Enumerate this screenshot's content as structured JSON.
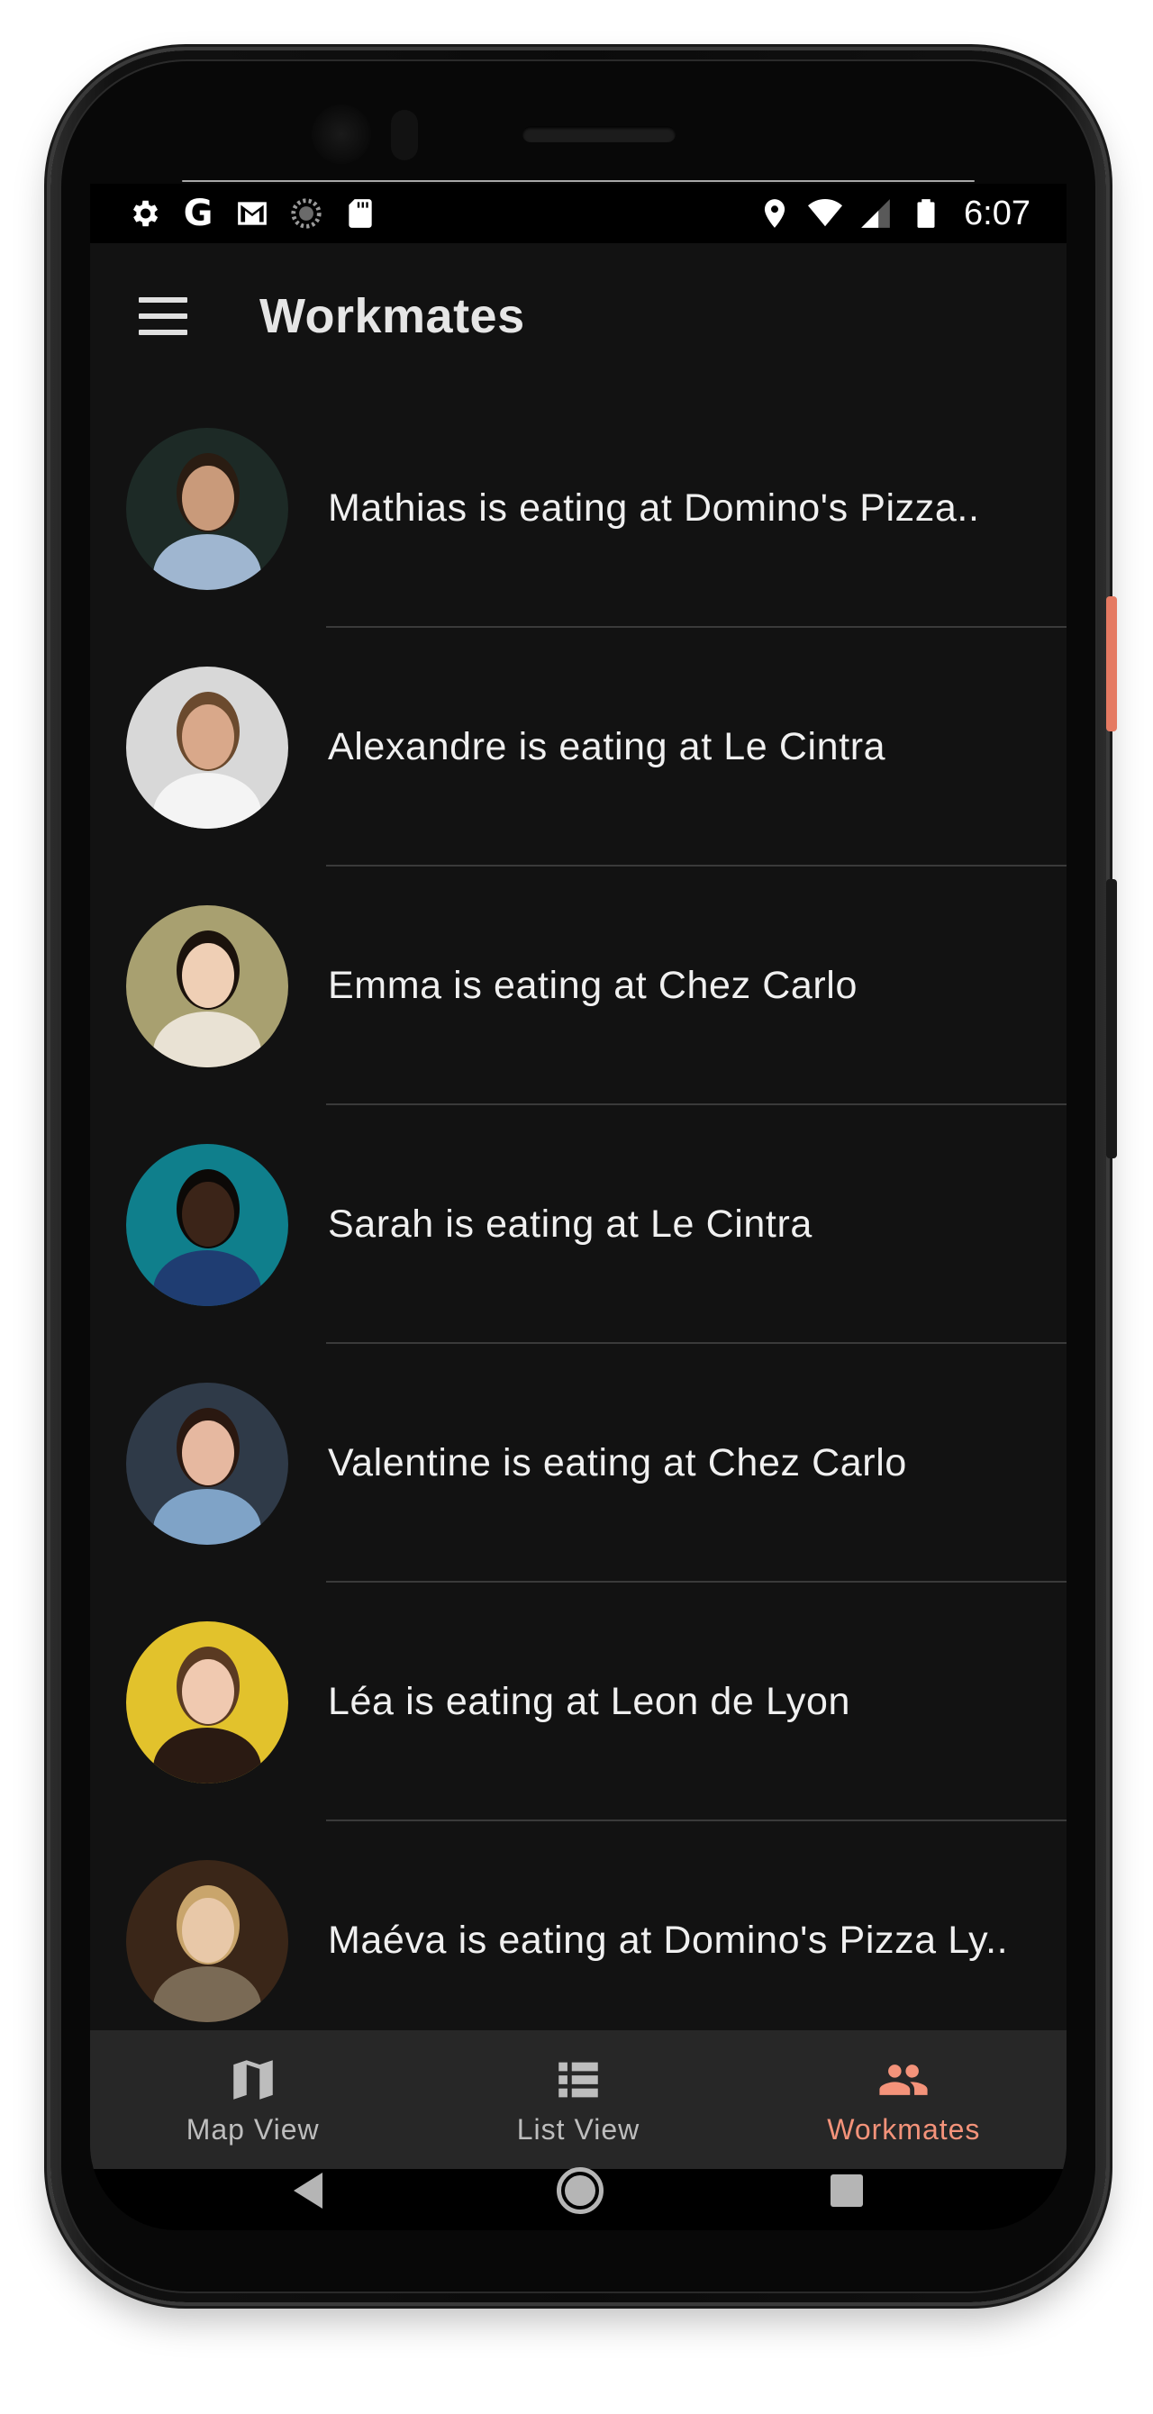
{
  "status_bar": {
    "time": "6:07",
    "left_icons": [
      "settings-icon",
      "google-icon",
      "gmail-icon",
      "loading-icon",
      "sd-card-icon"
    ],
    "right_icons": [
      "location-icon",
      "wifi-icon",
      "signal-icon",
      "battery-icon"
    ],
    "google_letter": "G"
  },
  "app_bar": {
    "title": "Workmates",
    "menu_icon": "menu-icon"
  },
  "workmates": [
    {
      "text": "Mathias is eating at Domino's Pizza..",
      "bg": "#1d2a26",
      "skin": "#c99a7a",
      "shirt": "#9fb6d0",
      "hair": "#2a1c12"
    },
    {
      "text": "Alexandre is eating at Le Cintra",
      "bg": "#d8d8d8",
      "skin": "#d9a88a",
      "shirt": "#f4f4f4",
      "hair": "#6b4a2e"
    },
    {
      "text": "Emma is eating at Chez Carlo",
      "bg": "#a8a070",
      "skin": "#efcfb5",
      "shirt": "#e9e2d4",
      "hair": "#1b120c"
    },
    {
      "text": "Sarah is eating at Le Cintra",
      "bg": "#0f7f8c",
      "skin": "#3b2418",
      "shirt": "#1f3d72",
      "hair": "#0c0907"
    },
    {
      "text": "Valentine is eating at Chez Carlo",
      "bg": "#2f3a48",
      "skin": "#e6b8a0",
      "shirt": "#7fa3c7",
      "hair": "#2a1810"
    },
    {
      "text": "Léa is eating at Leon de Lyon",
      "bg": "#e2c22c",
      "skin": "#f0c9b0",
      "shirt": "#2a1a12",
      "hair": "#5a3a22"
    },
    {
      "text": "Maéva is eating at Domino's Pizza Ly..",
      "bg": "#3a2618",
      "skin": "#e8c8a8",
      "shirt": "#7a6a55",
      "hair": "#c9a56c"
    }
  ],
  "bottom_nav": {
    "items": [
      {
        "label": "Map View",
        "icon": "map-icon",
        "active": false
      },
      {
        "label": "List View",
        "icon": "list-icon",
        "active": false
      },
      {
        "label": "Workmates",
        "icon": "people-icon",
        "active": true
      }
    ],
    "active_color": "#f4937a",
    "inactive_color": "#bdbdbd"
  },
  "system_nav": {
    "icons": [
      "back-icon",
      "home-icon",
      "recents-icon"
    ]
  }
}
